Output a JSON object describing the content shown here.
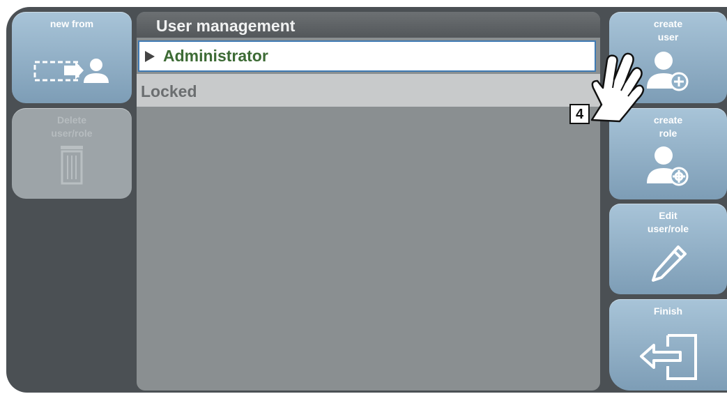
{
  "left_panel": {
    "new_from_label": "new from",
    "delete_label_line1": "Delete",
    "delete_label_line2": "user/role"
  },
  "list": {
    "title": "User management",
    "items": [
      {
        "label": "Administrator",
        "selected": true
      },
      {
        "label": "Locked",
        "selected": false
      }
    ]
  },
  "right_panel": {
    "create_user_line1": "create",
    "create_user_line2": "user",
    "create_role_line1": "create",
    "create_role_line2": "role",
    "edit_line1": "Edit",
    "edit_line2": "user/role",
    "finish_label": "Finish"
  },
  "annotation": {
    "step_number": "4"
  },
  "colors": {
    "tile_blue_top": "#a8c4d8",
    "tile_blue_bottom": "#7d9db6",
    "selected_text": "#3d6b35",
    "selection_border": "#3f7ab3",
    "frame_dark": "#4b5054"
  },
  "icons": [
    "user-copy-icon",
    "trash-icon",
    "add-user-icon",
    "add-role-icon",
    "pencil-icon",
    "exit-icon",
    "pointing-hand-icon"
  ]
}
